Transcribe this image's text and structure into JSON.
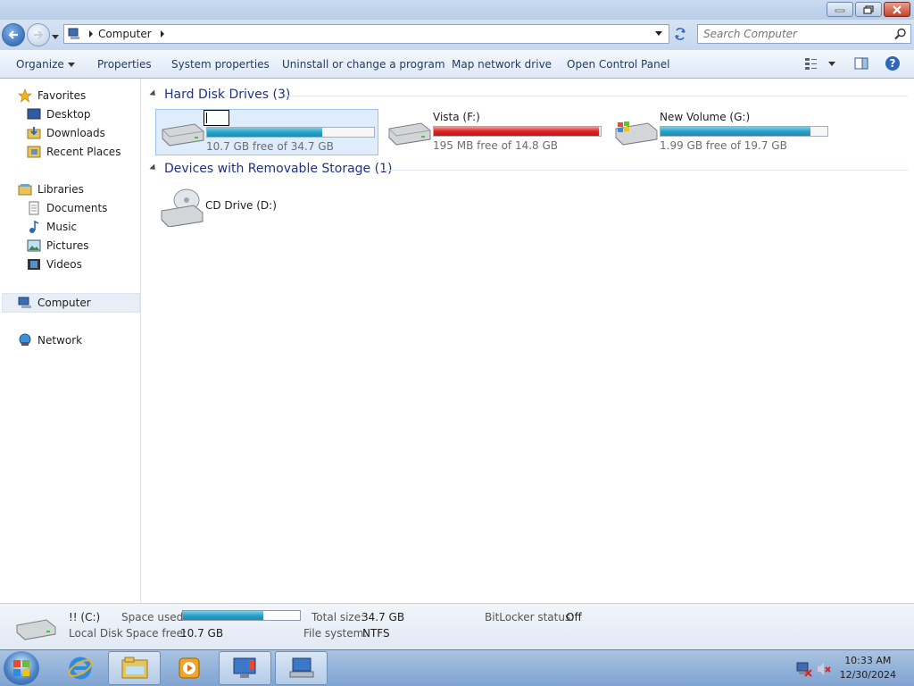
{
  "window": {
    "minimize": "minimize",
    "maximize": "restore",
    "close": "close"
  },
  "address": {
    "root_icon": "computer-icon",
    "crumb": "Computer"
  },
  "search": {
    "placeholder": "Search Computer"
  },
  "toolbar": {
    "organize": "Organize",
    "properties": "Properties",
    "system_properties": "System properties",
    "uninstall": "Uninstall or change a program",
    "map_drive": "Map network drive",
    "control_panel": "Open Control Panel"
  },
  "nav": {
    "favorites": "Favorites",
    "desktop": "Desktop",
    "downloads": "Downloads",
    "recent": "Recent Places",
    "libraries": "Libraries",
    "documents": "Documents",
    "music": "Music",
    "pictures": "Pictures",
    "videos": "Videos",
    "computer": "Computer",
    "network": "Network"
  },
  "groups": {
    "hdd": "Hard Disk Drives (3)",
    "removable": "Devices with Removable Storage (1)"
  },
  "drives": [
    {
      "name": "",
      "info": "10.7 GB free of 34.7 GB",
      "used_fraction": 0.69,
      "status": "normal",
      "selected": true
    },
    {
      "name": "Vista (F:)",
      "info": "195 MB free of 14.8 GB",
      "used_fraction": 0.99,
      "status": "critical"
    },
    {
      "name": "New Volume (G:)",
      "info": "1.99 GB free of 19.7 GB",
      "used_fraction": 0.9,
      "status": "normal"
    }
  ],
  "cd": {
    "name": "CD Drive (D:)"
  },
  "details": {
    "name": "!! (C:)",
    "type": "Local Disk",
    "space_used_label": "Space used:",
    "space_used_fraction": 0.69,
    "space_free_label": "Space free:",
    "space_free": "10.7 GB",
    "total_label": "Total size:",
    "total": "34.7 GB",
    "fs_label": "File system:",
    "fs": "NTFS",
    "bitlocker_label": "BitLocker status:",
    "bitlocker": "Off"
  },
  "clock": {
    "time": "10:33 AM",
    "date": "12/30/2024"
  },
  "colors": {
    "bar_normal": "#2aa1c9",
    "bar_critical": "#dd2222",
    "accent": "#1e3287"
  }
}
